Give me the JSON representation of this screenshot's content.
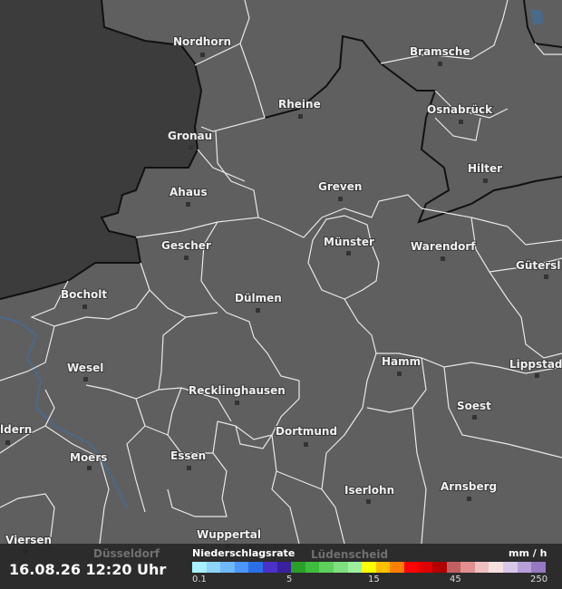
{
  "timestamp": "16.08.26 12:20 Uhr",
  "legend": {
    "title": "Niederschlagsrate",
    "unit": "mm / h",
    "ticks": [
      "0.1",
      "5",
      "15",
      "45",
      "250"
    ],
    "colors": [
      "#a7f0ff",
      "#8fd3ff",
      "#6fb7ff",
      "#4c96ff",
      "#2b6fe8",
      "#4a32c8",
      "#3a1f9e",
      "#2aa02a",
      "#3cbe3c",
      "#5ed05e",
      "#7ee07e",
      "#9ef09e",
      "#ffff00",
      "#ffc000",
      "#ff8000",
      "#ff0000",
      "#e00000",
      "#b00000",
      "#c06060",
      "#e09090",
      "#f0c0c0",
      "#f8e0e0",
      "#d8c8e8",
      "#b8a0d8",
      "#9878c0"
    ]
  },
  "cities": [
    {
      "name": "Nordhorn"
    },
    {
      "name": "Bramsche"
    },
    {
      "name": "Rheine"
    },
    {
      "name": "Osnabrück"
    },
    {
      "name": "Gronau"
    },
    {
      "name": "Hilter"
    },
    {
      "name": "Ahaus"
    },
    {
      "name": "Greven"
    },
    {
      "name": "Gescher"
    },
    {
      "name": "Münster"
    },
    {
      "name": "Warendorf"
    },
    {
      "name": "Gütersl"
    },
    {
      "name": "Bocholt"
    },
    {
      "name": "Dülmen"
    },
    {
      "name": "Wesel"
    },
    {
      "name": "Hamm"
    },
    {
      "name": "Lippstad"
    },
    {
      "name": "Recklinghausen"
    },
    {
      "name": "Soest"
    },
    {
      "name": "ldern"
    },
    {
      "name": "Dortmund"
    },
    {
      "name": "Moers"
    },
    {
      "name": "Essen"
    },
    {
      "name": "Iserlohn"
    },
    {
      "name": "Arnsberg"
    },
    {
      "name": "Viersen"
    },
    {
      "name": "Wuppertal"
    }
  ],
  "faded_cities": [
    "Düsseldorf",
    "Lüdenscheid"
  ]
}
